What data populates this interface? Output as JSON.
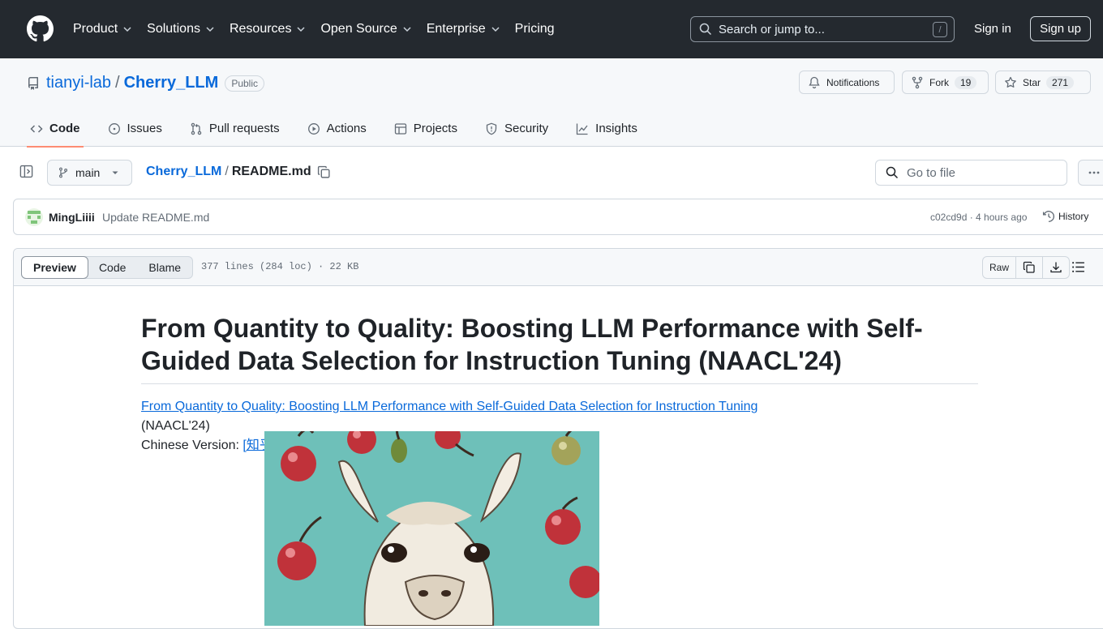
{
  "topnav": {
    "items": [
      "Product",
      "Solutions",
      "Resources",
      "Open Source",
      "Enterprise"
    ],
    "pricing": "Pricing",
    "search_placeholder": "Search or jump to...",
    "search_key": "/",
    "sign_in": "Sign in",
    "sign_up": "Sign up"
  },
  "repo": {
    "owner": "tianyi-lab",
    "separator": "/",
    "name": "Cherry_LLM",
    "visibility": "Public",
    "notifications_label": "Notifications",
    "fork_label": "Fork",
    "fork_count": "19",
    "star_label": "Star",
    "star_count": "271"
  },
  "tabs": [
    "Code",
    "Issues",
    "Pull requests",
    "Actions",
    "Projects",
    "Security",
    "Insights"
  ],
  "filenav": {
    "branch": "main",
    "crumb_repo": "Cherry_LLM",
    "crumb_sep": "/",
    "crumb_file": "README.md",
    "go_to_file": "Go to file"
  },
  "commit": {
    "author": "MingLiiii",
    "message": "Update README.md",
    "sha_time": "c02cd9d · 4 hours ago",
    "history": "History"
  },
  "file": {
    "modes": [
      "Preview",
      "Code",
      "Blame"
    ],
    "meta": "377 lines (284 loc) · 22 KB",
    "raw": "Raw"
  },
  "readme": {
    "title": "From Quantity to Quality: Boosting LLM Performance with Self-Guided Data Selection for Instruction Tuning (NAACL'24)",
    "paper_link": "From Quantity to Quality: Boosting LLM Performance with Self-Guided Data Selection for Instruction Tuning",
    "venue": "(NAACL'24)",
    "chinese_label": "Chinese Version: ",
    "chinese_link": "[知乎]"
  },
  "colors": {
    "header_bg": "#24292f",
    "link": "#0969da",
    "tab_underline": "#fd8c73",
    "image_bg": "#6ec0b9"
  }
}
